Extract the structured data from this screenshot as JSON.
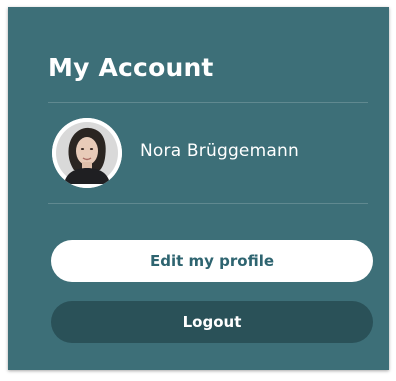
{
  "account": {
    "title": "My Account",
    "user_name": "Nora Brüggemann",
    "avatar_icon": "user-photo",
    "edit_profile_label": "Edit my profile",
    "logout_label": "Logout"
  },
  "colors": {
    "panel_bg": "#3d6f78",
    "edit_button_bg": "#ffffff",
    "edit_button_text": "#2e6470",
    "logout_button_bg": "#2a5158",
    "logout_button_text": "#ffffff"
  }
}
